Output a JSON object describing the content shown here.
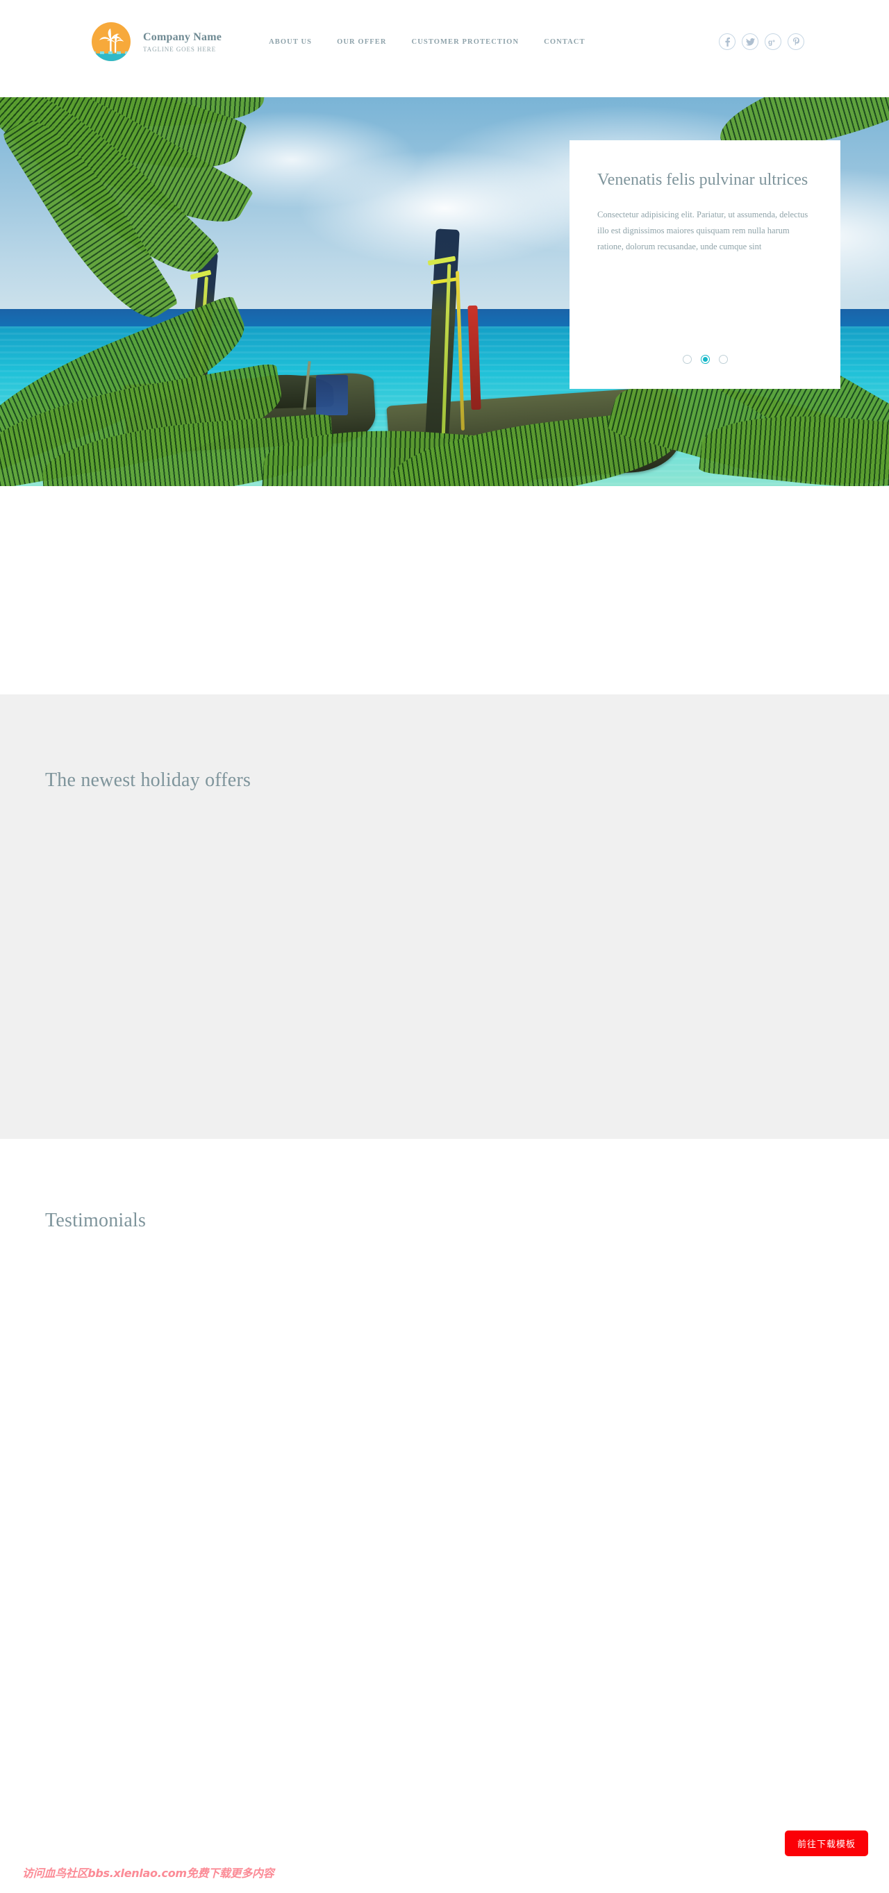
{
  "header": {
    "logo_icon": "palm-tree-sun-logo",
    "company_name": "Company Name",
    "tagline": "TAGLINE GOES HERE",
    "nav": [
      {
        "label": "ABOUT US"
      },
      {
        "label": "OUR OFFER"
      },
      {
        "label": "CUSTOMER PROTECTION"
      },
      {
        "label": "CONTACT"
      }
    ],
    "social": [
      {
        "name": "facebook-icon",
        "glyph": "f"
      },
      {
        "name": "twitter-icon",
        "glyph": "ᴠ"
      },
      {
        "name": "google-plus-icon",
        "glyph": "g⁺"
      },
      {
        "name": "pinterest-icon",
        "glyph": "Ⓟ"
      }
    ]
  },
  "hero": {
    "image_alt": "tropical-beach-longtail-boats",
    "card": {
      "title": "Venenatis felis pulvinar ultrices",
      "body": "Consectetur adipisicing elit. Pariatur, ut assumenda, delectus illo est dignissimos maiores quisquam rem nulla harum ratione, dolorum recusandae, unde cumque sint",
      "dots": [
        {
          "active": false
        },
        {
          "active": true
        },
        {
          "active": false
        }
      ],
      "active_dot_color": "#17b8c8"
    }
  },
  "sections": {
    "offers_title": "The newest holiday offers",
    "testimonials_title": "Testimonials",
    "offers_bg": "#f0f0f0"
  },
  "overlay": {
    "download_button": "前往下载模板",
    "download_button_color": "#fb0007",
    "watermark": "访问血鸟社区bbs.xlenlao.com免费下载更多内容",
    "watermark_color": "#fb8b96"
  }
}
